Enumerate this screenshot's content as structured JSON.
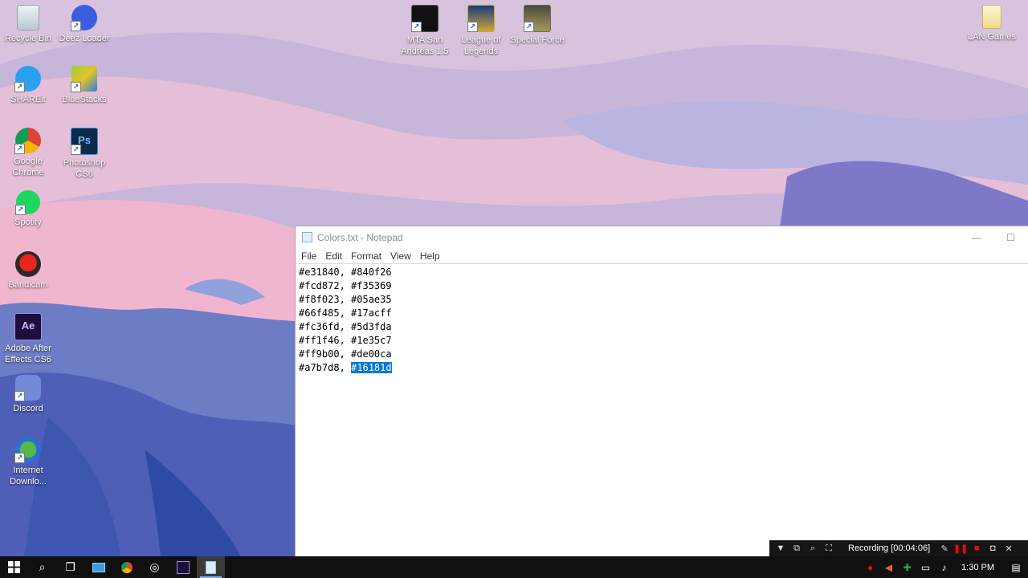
{
  "desktop": {
    "icons": [
      {
        "label": "Recycle Bin",
        "icon": "recycle-bin-icon"
      },
      {
        "label": "Deez Loader",
        "icon": "deez-loader-icon"
      },
      {
        "label": "SHAREit",
        "icon": "shareit-icon"
      },
      {
        "label": "BlueStacks",
        "icon": "bluestacks-icon"
      },
      {
        "label": "Google Chrome",
        "icon": "chrome-icon"
      },
      {
        "label": "Photoshop CS6",
        "icon": "photoshop-icon"
      },
      {
        "label": "Spotify",
        "icon": "spotify-icon"
      },
      {
        "label": "Bandicam",
        "icon": "bandicam-icon"
      },
      {
        "label": "Adobe After Effects CS6",
        "icon": "after-effects-icon"
      },
      {
        "label": "Discord",
        "icon": "discord-icon"
      },
      {
        "label": "Internet Downlo...",
        "icon": "internet-download-manager-icon"
      },
      {
        "label": "MTA San Andreas 1.5",
        "icon": "mta-icon"
      },
      {
        "label": "League of Legends",
        "icon": "league-of-legends-icon"
      },
      {
        "label": "Special Force",
        "icon": "special-force-icon"
      },
      {
        "label": "LAN Games",
        "icon": "folder-icon"
      }
    ]
  },
  "notepad": {
    "title": "Colors.txt - Notepad",
    "controls": {
      "minimize": "—",
      "maximize": "☐"
    },
    "menu": [
      "File",
      "Edit",
      "Format",
      "View",
      "Help"
    ],
    "lines": [
      "#e31840, #840f26",
      "#fcd872, #f35369",
      "#f8f023, #05ae35",
      "#66f485, #17acff",
      "#fc36fd, #5d3fda",
      "#ff1f46, #1e35c7",
      "#ff9b00, #de00ca"
    ],
    "last_line_prefix": "#a7b7d8, ",
    "selected_text": "#16181d"
  },
  "recorder": {
    "status": "Recording [00:04:06]"
  },
  "taskbar": {
    "time": "1:30 PM"
  },
  "colors": {
    "accent": "#0078d7",
    "taskbar": "#101010"
  }
}
